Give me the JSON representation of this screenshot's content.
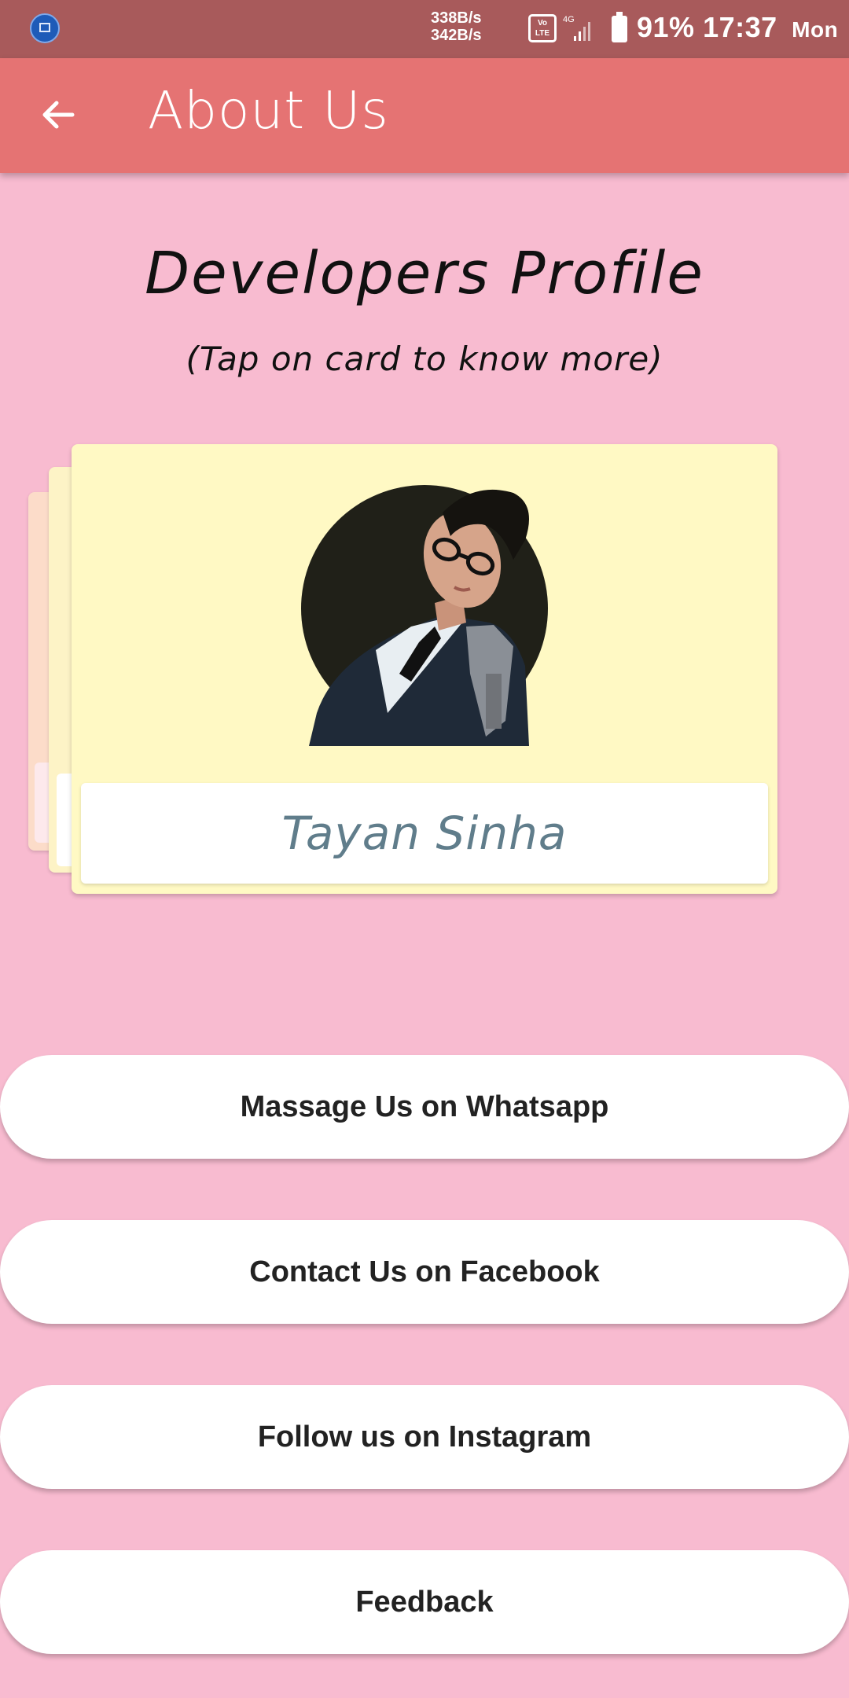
{
  "status_bar": {
    "net_up": "338B/s",
    "net_down": "342B/s",
    "volte_top": "Vo",
    "volte_bottom": "LTE",
    "network_type": "4G",
    "battery": "91%",
    "time": "17:37",
    "day": "Mon"
  },
  "app_bar": {
    "title": "About Us"
  },
  "page": {
    "heading": "Developers Profile",
    "subheading": "(Tap on card to know more)"
  },
  "profile_card": {
    "name": "Tayan Sinha"
  },
  "buttons": {
    "whatsapp": "Massage Us on Whatsapp",
    "facebook": "Contact Us on Facebook",
    "instagram": "Follow us on Instagram",
    "feedback": "Feedback"
  },
  "colors": {
    "status_bar": "#a85a5b",
    "app_bar": "#e57373",
    "background": "#f8bbd0",
    "card": "#fff9c4"
  }
}
